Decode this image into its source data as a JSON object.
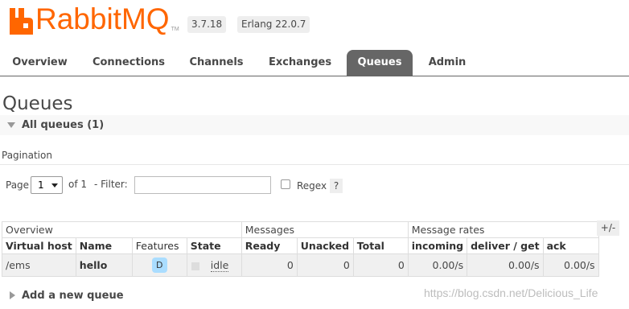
{
  "brand": {
    "name": "RabbitMQ",
    "tm": "TM",
    "accent_color": "#ff6600"
  },
  "header": {
    "version": "3.7.18",
    "erlang": "Erlang 22.0.7"
  },
  "tabs": [
    {
      "label": "Overview"
    },
    {
      "label": "Connections"
    },
    {
      "label": "Channels"
    },
    {
      "label": "Exchanges"
    },
    {
      "label": "Queues",
      "active": true
    },
    {
      "label": "Admin"
    }
  ],
  "page": {
    "title": "Queues",
    "section_title": "All queues (1)",
    "pagination_label": "Pagination"
  },
  "controls": {
    "page_label": "Page",
    "page_value": "1",
    "of_label": "of 1",
    "filter_label": "- Filter:",
    "filter_value": "",
    "regex_label": "Regex",
    "help": "?"
  },
  "table": {
    "groups": [
      "Overview",
      "Messages",
      "Message rates"
    ],
    "columns": [
      "Virtual host",
      "Name",
      "Features",
      "State",
      "Ready",
      "Unacked",
      "Total",
      "incoming",
      "deliver / get",
      "ack"
    ],
    "rows": [
      {
        "vhost": "/ems",
        "name": "hello",
        "features": "D",
        "state": "idle",
        "ready": "0",
        "unacked": "0",
        "total": "0",
        "incoming": "0.00/s",
        "deliver_get": "0.00/s",
        "ack": "0.00/s"
      }
    ],
    "toggle_columns": "+/-"
  },
  "footer": {
    "add_queue": "Add a new queue",
    "watermark": "https://blog.csdn.net/Delicious_Life"
  },
  "icons": [
    "rabbitmq-logo-icon",
    "collapse-triangle-icon",
    "expand-triangle-icon",
    "dropdown-caret-icon"
  ]
}
